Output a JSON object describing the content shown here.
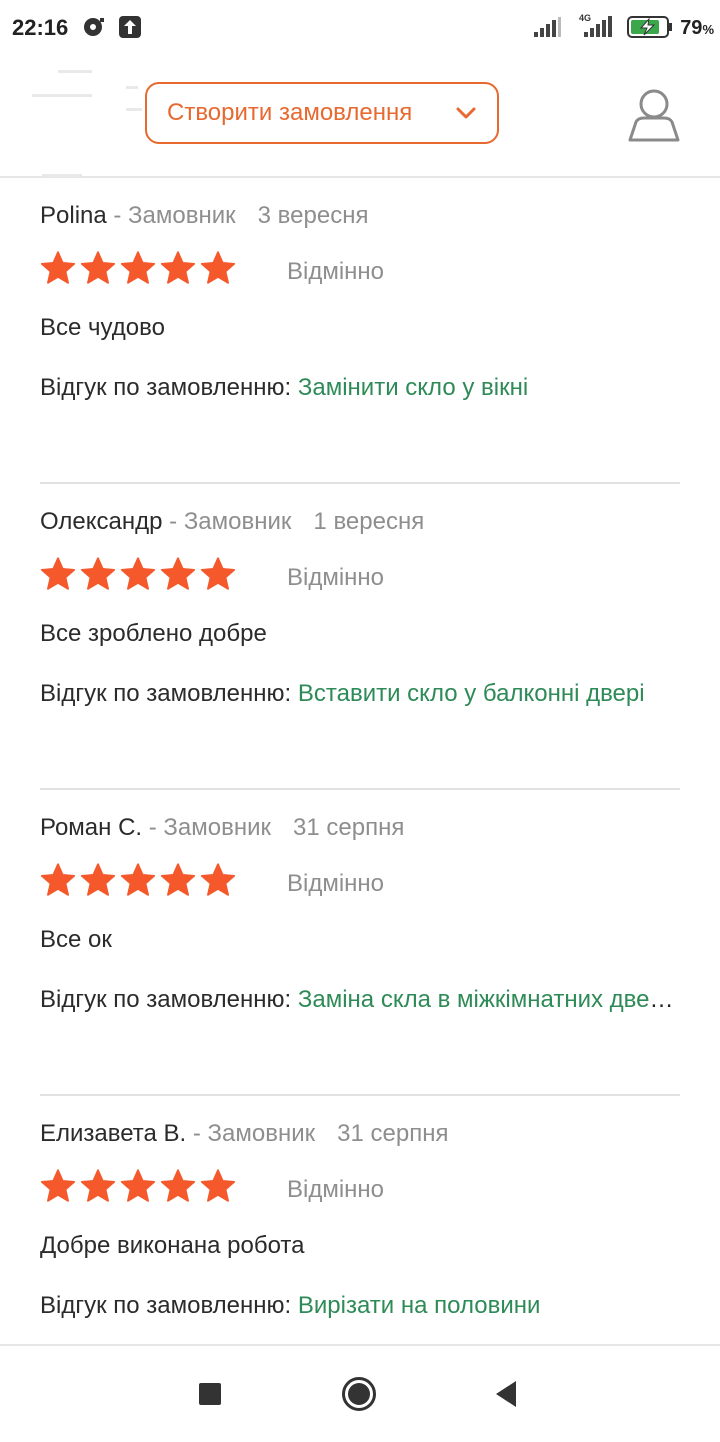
{
  "status_bar": {
    "time": "22:16",
    "network": "4G",
    "battery_percent": "79",
    "battery_unit": "%",
    "icons": [
      "media-icon",
      "upload-icon",
      "signal-icon",
      "signal-4g-icon",
      "battery-charging-icon"
    ]
  },
  "header": {
    "create_order_label": "Створити замовлення",
    "icons": [
      "chevron-down-icon",
      "profile-icon"
    ]
  },
  "colors": {
    "accent": "#e8692f",
    "star": "#f5582a",
    "link": "#2e8a57",
    "muted": "#8e8e8e"
  },
  "reviews": [
    {
      "name": "Polina",
      "role": " - Замовник",
      "date": "3 вересня",
      "stars": 5,
      "rating_label": "Відмінно",
      "text": "Все чудово",
      "order_label": "Відгук по замовленню: ",
      "order_title": "Замінити скло у вікні"
    },
    {
      "name": "Олександр",
      "role": " - Замовник",
      "date": "1 вересня",
      "stars": 5,
      "rating_label": "Відмінно",
      "text": "Все зроблено добре",
      "order_label": "Відгук по замовленню: ",
      "order_title": "Вставити скло у балконні двері"
    },
    {
      "name": "Роман С.",
      "role": " - Замовник",
      "date": "31 серпня",
      "stars": 5,
      "rating_label": "Відмінно",
      "text": "Все ок",
      "order_label": "Відгук по замовленню: ",
      "order_title": "Заміна скла в міжкімнатних дверях"
    },
    {
      "name": "Елизавета В.",
      "role": " - Замовник",
      "date": "31 серпня",
      "stars": 5,
      "rating_label": "Відмінно",
      "text": "Добре виконана робота",
      "order_label": "Відгук по замовленню: ",
      "order_title": "Вирізати на половини"
    }
  ],
  "nav_bar": {
    "buttons": [
      "recent-apps-icon",
      "home-icon",
      "back-icon"
    ]
  }
}
